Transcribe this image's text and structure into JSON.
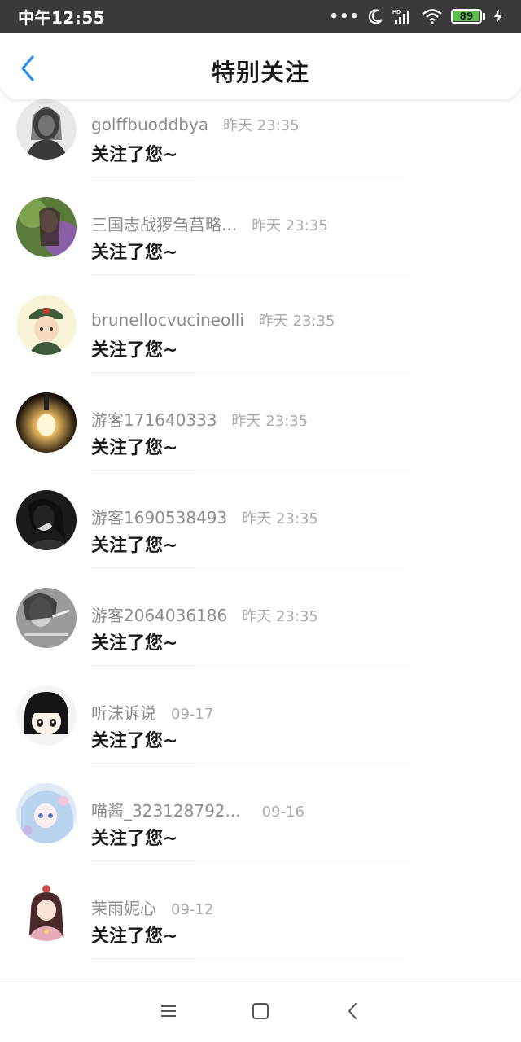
{
  "status_bar": {
    "time": "中午12:55",
    "dots": "•••",
    "battery_level": "89"
  },
  "header": {
    "title": "特别关注"
  },
  "items": [
    {
      "name": "golffbuoddbya",
      "time": "昨天 23:35",
      "message": "关注了您~"
    },
    {
      "name": "三国志战猡刍莒略...",
      "time": "昨天 23:35",
      "message": "关注了您~"
    },
    {
      "name": "brunellocvucineolli",
      "time": "昨天 23:35",
      "message": "关注了您~"
    },
    {
      "name": "游客171640333",
      "time": "昨天 23:35",
      "message": "关注了您~"
    },
    {
      "name": "游客1690538493",
      "time": "昨天 23:35",
      "message": "关注了您~"
    },
    {
      "name": "游客2064036186",
      "time": "昨天 23:35",
      "message": "关注了您~"
    },
    {
      "name": "听沫诉说",
      "time": "09-17",
      "message": "关注了您~"
    },
    {
      "name": "喵酱_323128792...",
      "time": "09-16",
      "message": "关注了您~"
    },
    {
      "name": "茉雨妮心",
      "time": "09-12",
      "message": "关注了您~"
    }
  ],
  "colors": {
    "accent": "#2a8ef0",
    "status_bar": "#3a3a3a",
    "battery": "#5ac24a"
  }
}
